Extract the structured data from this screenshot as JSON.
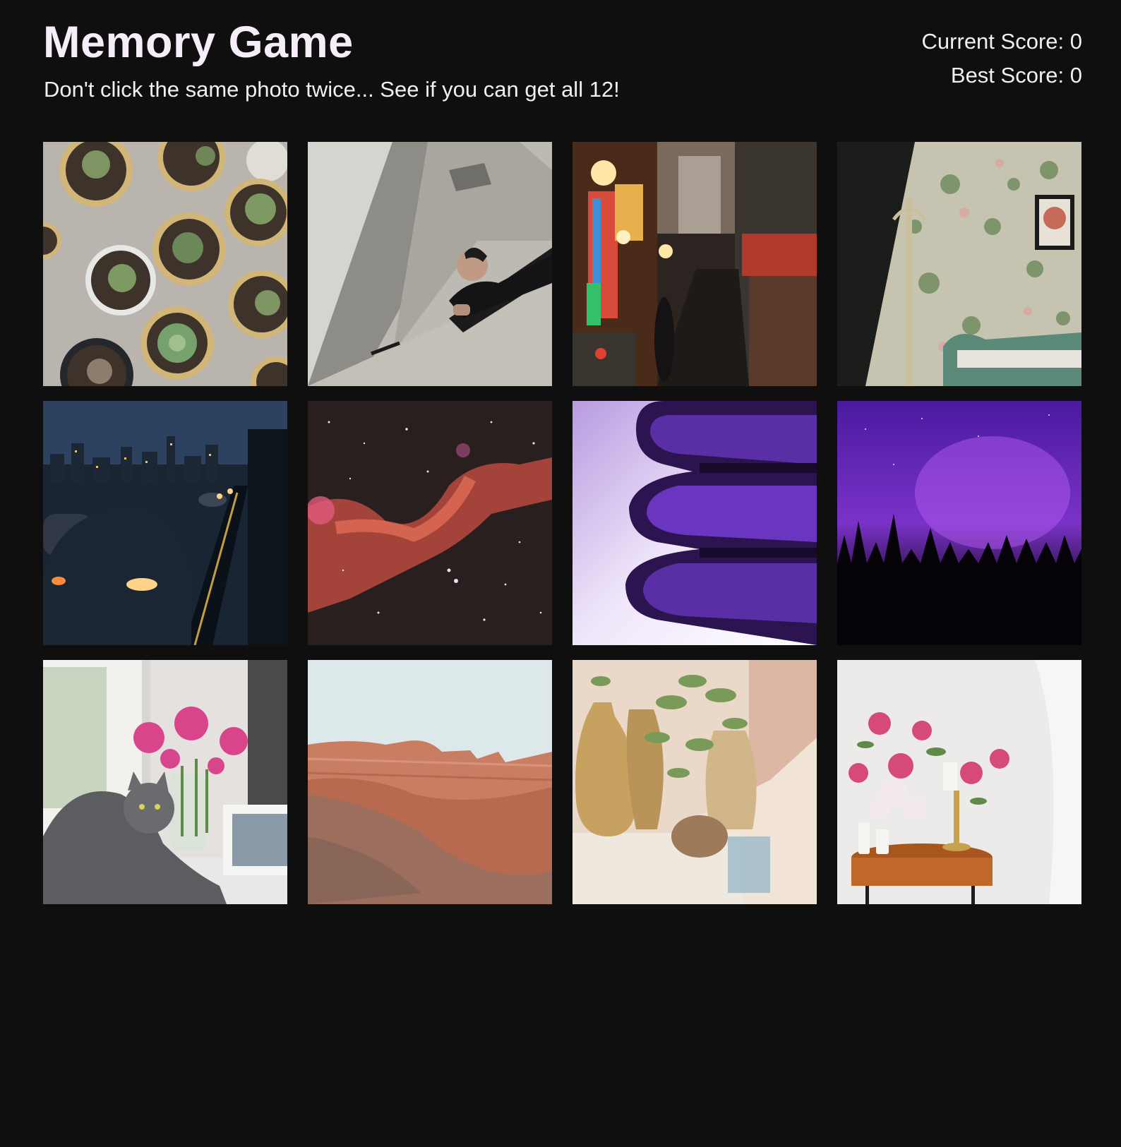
{
  "game": {
    "title": "Memory Game",
    "instructions": "Don't click the same photo twice... See if you can get all 12!"
  },
  "scoreboard": {
    "current_label": "Current Score: ",
    "current_value": "0",
    "best_label": "Best Score: ",
    "best_value": "0"
  },
  "colors": {
    "background": "#0f0f0f",
    "text": "#f3eef7"
  },
  "cards": [
    {
      "id": "succulents",
      "subject": "potted succulents viewed from above"
    },
    {
      "id": "man-balcony",
      "subject": "man leaning over concrete balcony"
    },
    {
      "id": "night-alley",
      "subject": "neon-lit street alley at night"
    },
    {
      "id": "floral-wall",
      "subject": "floral wallpaper with coat rack and green bench"
    },
    {
      "id": "city-traffic",
      "subject": "city traffic at dusk with skyline"
    },
    {
      "id": "nebula",
      "subject": "red nebula in starfield"
    },
    {
      "id": "purple-wave",
      "subject": "glossy purple wavy 3D shape"
    },
    {
      "id": "aurora",
      "subject": "purple aurora over forest silhouette"
    },
    {
      "id": "cat-flowers",
      "subject": "grey cat by window with pink peonies"
    },
    {
      "id": "canyon",
      "subject": "red rock canyon under pale sky"
    },
    {
      "id": "vases-plants",
      "subject": "ceramic vases and green plants"
    },
    {
      "id": "peony-table",
      "subject": "pink peonies and candles on wooden table"
    }
  ]
}
